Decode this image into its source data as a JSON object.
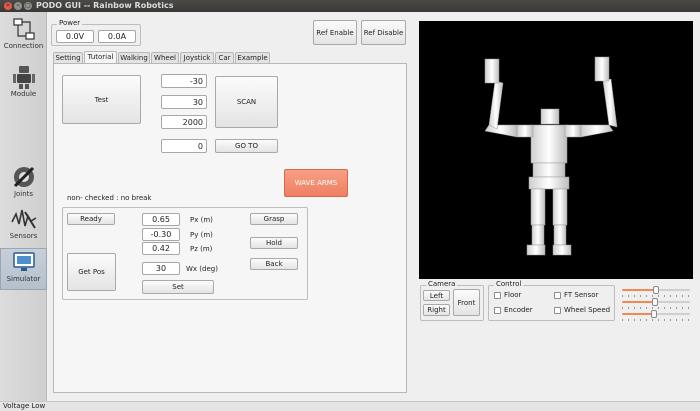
{
  "window": {
    "title": "PODO GUI -- Rainbow Robotics"
  },
  "sidebar": {
    "items": [
      {
        "label": "Connection",
        "icon": "network-icon"
      },
      {
        "label": "Module",
        "icon": "robot-icon"
      },
      {
        "label": "Joints",
        "icon": "joints-icon"
      },
      {
        "label": "Sensors",
        "icon": "sensors-icon"
      },
      {
        "label": "Simulator",
        "icon": "monitor-icon"
      }
    ],
    "active": "Simulator"
  },
  "power": {
    "title": "Power",
    "voltage": "0.0V",
    "current": "0.0A"
  },
  "ref_buttons": {
    "enable": "Ref Enable",
    "disable": "Ref Disable"
  },
  "tabs": [
    "Setting",
    "Tutorial",
    "Walking",
    "Wheel",
    "Joystick",
    "Car",
    "Example"
  ],
  "active_tab": "Tutorial",
  "tutorial": {
    "test_button": "Test",
    "scan_values": [
      "-30",
      "30",
      "2000"
    ],
    "scan_button": "SCAN",
    "goto_value": "0",
    "goto_button": "GO TO",
    "wave_button": "WAVE ARMS",
    "note": "non- checked : no break",
    "ready_button": "Ready",
    "getpos_button": "Get Pos",
    "positions": [
      {
        "value": "0.65",
        "label": "Px (m)"
      },
      {
        "value": "-0.30",
        "label": "Py (m)"
      },
      {
        "value": "0.42",
        "label": "Pz (m)"
      }
    ],
    "wx": {
      "value": "30",
      "label": "Wx (deg)"
    },
    "set_button": "Set",
    "grasp_button": "Grasp",
    "hold_button": "Hold",
    "back_button": "Back"
  },
  "camera": {
    "title": "Camera",
    "left": "Left",
    "right": "Right",
    "front": "Front"
  },
  "control": {
    "title": "Control",
    "options": [
      "Floor",
      "FT Sensor",
      "Encoder",
      "Wheel Speed"
    ]
  },
  "sliders": [
    0.5,
    0.49,
    0.47
  ],
  "accent_colors": {
    "orange": "#ef7f62",
    "active_nav": "#b6c0cc"
  },
  "status": {
    "text": "Voltage Low"
  }
}
